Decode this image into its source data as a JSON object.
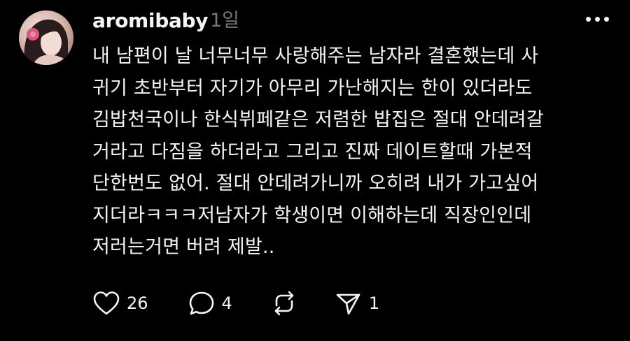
{
  "post": {
    "username": "aromibaby",
    "time": "1일",
    "body_lines": [
      "내 남편이 날 너무너무 사랑해주는 남자라 결혼했는데 사",
      "귀기 초반부터 자기가 아무리 가난해지는 한이 있더라도",
      "김밥천국이나 한식뷔페같은 저렴한 밥집은 절대 안데려갈",
      "거라고 다짐을 하더라고 그리고 진짜 데이트할때 가본적",
      "단한번도 없어. 절대 안데려가니까 오히려 내가 가고싶어",
      "지더라ㅋㅋㅋ저남자가 학생이면 이해하는데 직장인인데",
      "저러는거면 버려 제발.."
    ]
  },
  "actions": {
    "like_count": "26",
    "reply_count": "4",
    "share_count": "1"
  },
  "icons": {
    "more": "more-horizontal-icon",
    "like": "heart-icon",
    "reply": "comment-bubble-icon",
    "repost": "repost-icon",
    "share": "send-icon"
  },
  "colors": {
    "background": "#000000",
    "text": "#f3f5f7",
    "muted": "#777777"
  }
}
